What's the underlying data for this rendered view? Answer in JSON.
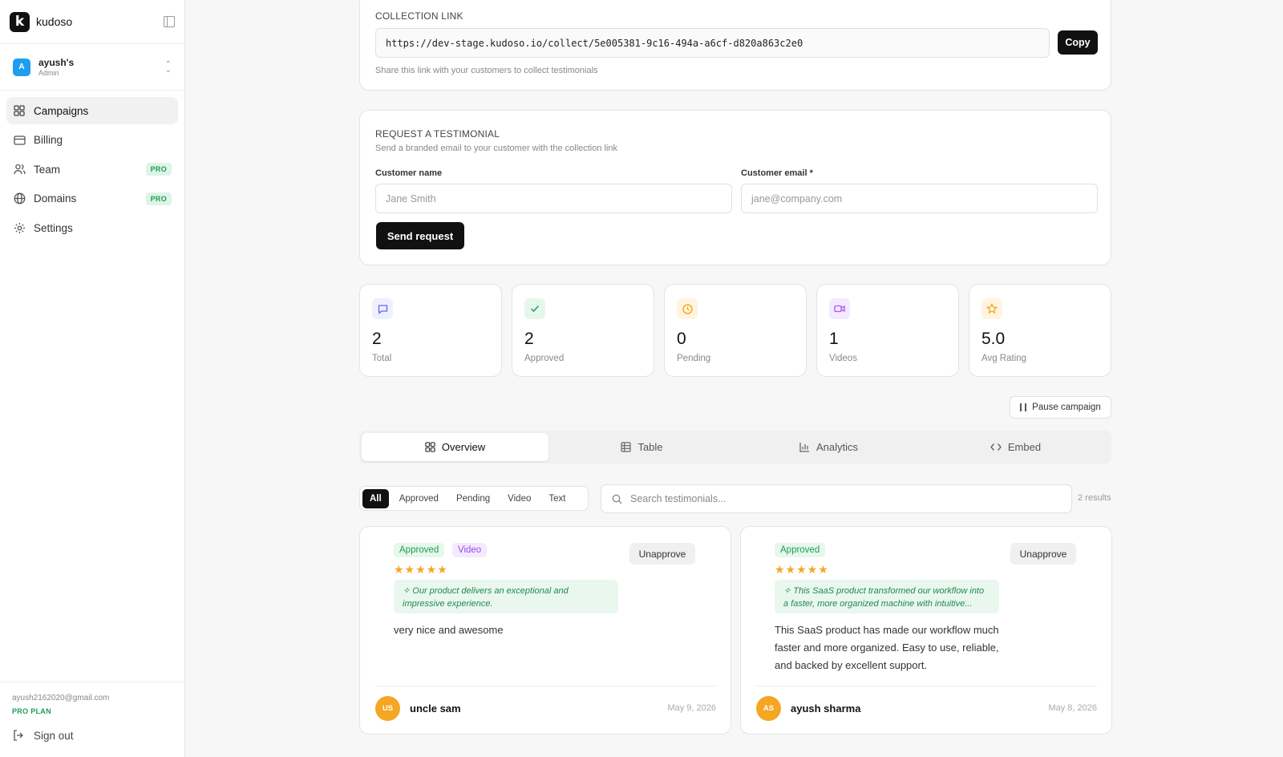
{
  "app": {
    "name": "kudoso",
    "logo_letter": "k"
  },
  "workspace": {
    "initial": "A",
    "name": "ayush's",
    "role": "Admin"
  },
  "nav": {
    "items": [
      {
        "label": "Campaigns",
        "icon": "grid-icon",
        "active": true
      },
      {
        "label": "Billing",
        "icon": "credit-card-icon"
      },
      {
        "label": "Team",
        "icon": "users-icon",
        "badge": "PRO"
      },
      {
        "label": "Domains",
        "icon": "globe-icon",
        "badge": "PRO"
      },
      {
        "label": "Settings",
        "icon": "gear-icon"
      }
    ]
  },
  "user": {
    "email": "ayush2162020@gmail.com",
    "plan": "PRO PLAN",
    "signout_label": "Sign out"
  },
  "collection": {
    "title": "COLLECTION LINK",
    "url": "https://dev-stage.kudoso.io/collect/5e005381-9c16-494a-a6cf-d820a863c2e0",
    "copy_label": "Copy",
    "hint": "Share this link with your customers to collect testimonials"
  },
  "request": {
    "title": "REQUEST A TESTIMONIAL",
    "subtitle": "Send a branded email to your customer with the collection link",
    "name_label": "Customer name",
    "name_placeholder": "Jane Smith",
    "email_label": "Customer email *",
    "email_placeholder": "jane@company.com",
    "send_label": "Send request"
  },
  "stats": [
    {
      "value": "2",
      "label": "Total",
      "icon": "message-icon",
      "color": "#6366f1",
      "bg": "#eef0ff"
    },
    {
      "value": "2",
      "label": "Approved",
      "icon": "check-icon",
      "color": "#22a05b",
      "bg": "#e6f7ec"
    },
    {
      "value": "0",
      "label": "Pending",
      "icon": "clock-icon",
      "color": "#f59e0b",
      "bg": "#fff4e0"
    },
    {
      "value": "1",
      "label": "Videos",
      "icon": "video-icon",
      "color": "#a855f7",
      "bg": "#f3eaff"
    },
    {
      "value": "5.0",
      "label": "Avg Rating",
      "icon": "star-icon",
      "color": "#f5a623",
      "bg": "#fff4e0"
    }
  ],
  "pause_label": "Pause campaign",
  "tabs": [
    {
      "label": "Overview",
      "icon": "grid-icon",
      "active": true
    },
    {
      "label": "Table",
      "icon": "table-icon"
    },
    {
      "label": "Analytics",
      "icon": "bar-chart-icon"
    },
    {
      "label": "Embed",
      "icon": "code-icon"
    }
  ],
  "filters": [
    "All",
    "Approved",
    "Pending",
    "Video",
    "Text"
  ],
  "search": {
    "placeholder": "Search testimonials..."
  },
  "results": "2 results",
  "testimonials": [
    {
      "tags": [
        "Approved",
        "Video"
      ],
      "rating": 5,
      "stars": "★★★★★",
      "action": "Unapprove",
      "summary": "Our product delivers an exceptional and impressive experience.",
      "text": "very nice and awesome",
      "initials": "US",
      "author": "uncle sam",
      "date": "May 9, 2026"
    },
    {
      "tags": [
        "Approved"
      ],
      "rating": 5,
      "stars": "★★★★★",
      "action": "Unapprove",
      "summary": "This SaaS product transformed our workflow into a faster, more organized machine with intuitive...",
      "text": "This SaaS product has made our workflow much faster and more organized. Easy to use, reliable, and backed by excellent support.",
      "initials": "AS",
      "author": "ayush sharma",
      "date": "May 8, 2026"
    }
  ],
  "colors": {
    "accent": "#111111",
    "pro": "#1f9d55",
    "star": "#f5a623"
  }
}
